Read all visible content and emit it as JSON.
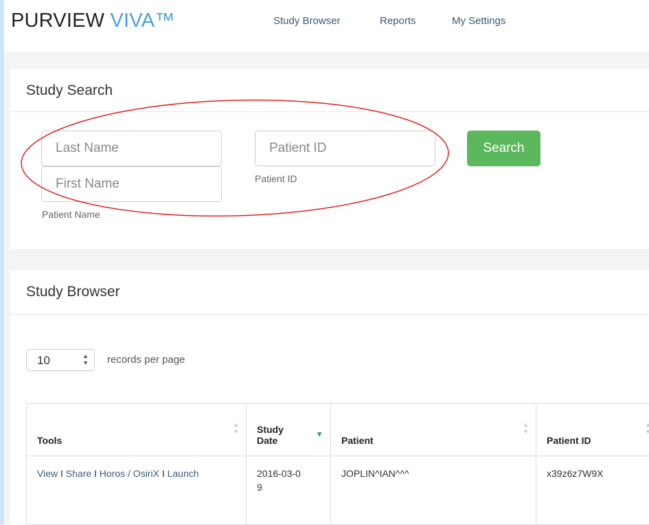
{
  "brand": {
    "name": "PURVIEW",
    "accent": "VIVA™",
    "accent_color": "#4a9fe0"
  },
  "nav": [
    {
      "label": "Study Browser"
    },
    {
      "label": "Reports"
    },
    {
      "label": "My Settings"
    }
  ],
  "study_search": {
    "title": "Study Search",
    "last_name_placeholder": "Last Name",
    "first_name_placeholder": "First Name",
    "patient_name_help": "Patient Name",
    "patient_id_placeholder": "Patient ID",
    "patient_id_help": "Patient ID",
    "search_label": "Search",
    "search_color": "#5cb85c"
  },
  "study_browser": {
    "title": "Study Browser",
    "page_size": "10",
    "page_size_label": "records per page",
    "columns": [
      "Tools",
      "Study Date",
      "Patient",
      "Patient ID"
    ],
    "rows": [
      {
        "tools": [
          "View",
          "Share",
          "Horos / OsiriX",
          "Launch"
        ],
        "tool_separator": "I",
        "study_date": "2016-03-09",
        "patient": "JOPLIN^IAN^^^",
        "patient_id": "x39z6z7W9X"
      }
    ]
  },
  "annotation": {
    "color": "#e02020"
  }
}
